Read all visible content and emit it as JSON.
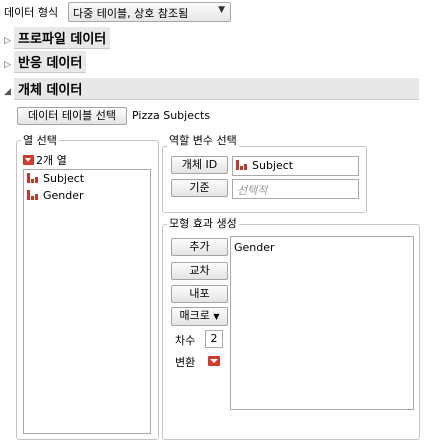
{
  "format": {
    "label": "데이터 형식",
    "value": "다중 테이블, 상호 참조됨"
  },
  "outlines": {
    "profile": "프로파일 데이터",
    "response": "반응 데이터",
    "subject": "개체 데이터"
  },
  "subject_section": {
    "select_table_label": "데이터 테이블 선택",
    "table_name": "Pizza Subjects"
  },
  "columns": {
    "title": "열 선택",
    "count_label": "2개 열",
    "items": [
      "Subject",
      "Gender"
    ]
  },
  "roles": {
    "title": "역할 변수 선택",
    "subject_id_label": "개체 ID",
    "subject_id_value": "Subject",
    "by_label": "기준",
    "by_placeholder": "선택적"
  },
  "model": {
    "title": "모형 효과 생성",
    "add_label": "추가",
    "cross_label": "교차",
    "nest_label": "내포",
    "macros_label": "매크로",
    "degree_label": "차수",
    "degree_value": "2",
    "transform_label": "변환",
    "effects": [
      "Gender"
    ]
  },
  "colors": {
    "nominal_icon": "#c0392b",
    "red_dropdown": "#d23a2a"
  }
}
